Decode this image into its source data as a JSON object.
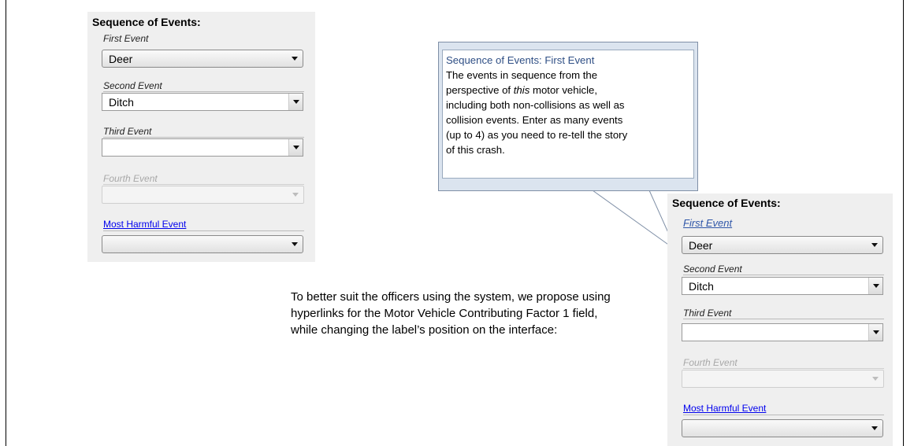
{
  "left_panel": {
    "title": "Sequence of Events:",
    "fields": [
      {
        "label": "First Event",
        "value": "Deer"
      },
      {
        "label": "Second Event",
        "value": "Ditch"
      },
      {
        "label": "Third Event",
        "value": ""
      },
      {
        "label": "Fourth Event",
        "value": ""
      },
      {
        "label": "Most Harmful Event",
        "value": ""
      }
    ]
  },
  "tooltip": {
    "title": "Sequence  of Events: First Event",
    "line1": "The events in sequence  from the",
    "line2_pre": "perspective of ",
    "line2_em": "this",
    "line2_post": " motor vehicle,",
    "line3": "including both non-collisions as well as",
    "line4": "collision events.  Enter as many events",
    "line5": "(up to 4) as you need to re-tell the story",
    "line6": "of this crash."
  },
  "right_panel": {
    "title": "Sequence of Events:",
    "fields": [
      {
        "label": "First Event",
        "value": "Deer"
      },
      {
        "label": "Second Event",
        "value": "Ditch"
      },
      {
        "label": "Third Event",
        "value": ""
      },
      {
        "label": "Fourth Event",
        "value": ""
      },
      {
        "label": "Most Harmful Event",
        "value": ""
      }
    ]
  },
  "description": {
    "line1": "To better suit the officers using the system, we propose using",
    "line2": "hyperlinks for the Motor Vehicle Contributing Factor 1 field,",
    "line3": "while changing the label’s position on the interface:"
  }
}
